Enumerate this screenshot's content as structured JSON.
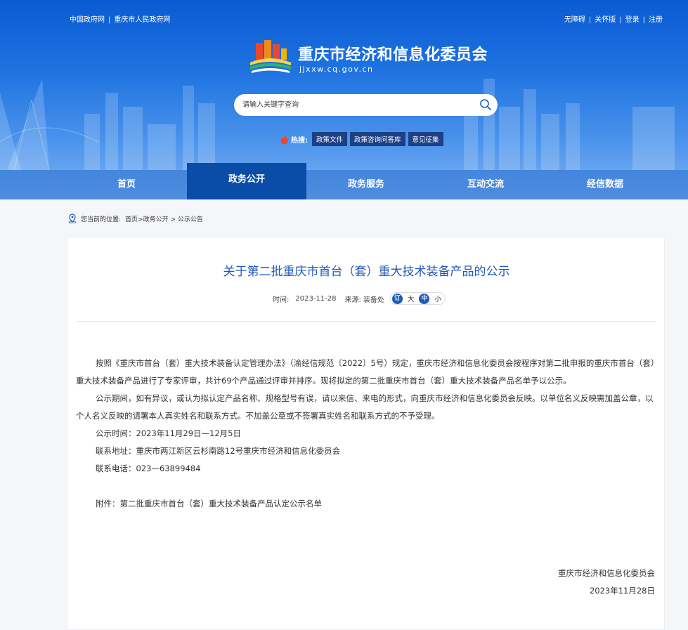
{
  "topbar": {
    "left_links": [
      "中国政府网",
      "重庆市人民政府网"
    ],
    "right_links": [
      "无障碍",
      "关怀版",
      "登录",
      "注册"
    ]
  },
  "site": {
    "title": "重庆市经济和信息化委员会",
    "url": "jjxxw.cq.gov.cn"
  },
  "search": {
    "placeholder": "请输入关键字查询"
  },
  "hot": {
    "label": "热搜:",
    "tags": [
      "政策文件",
      "政策咨询问答库",
      "意见征集"
    ]
  },
  "nav": {
    "items": [
      "首页",
      "政务公开",
      "政务服务",
      "互动交流",
      "经信数据"
    ],
    "active_index": 1
  },
  "breadcrumb": {
    "prefix": "您当前的位置:",
    "path": "首页>政务公开 > 公示公告"
  },
  "article": {
    "title": "关于第二批重庆市首台（套）重大技术装备产品的公示",
    "time_label": "时间:",
    "time_value": "2023-11-28",
    "source_label": "来源:",
    "source_value": "装备处",
    "size_controls": [
      "订",
      "大",
      "中",
      "小"
    ],
    "paragraphs": [
      "按照《重庆市首台（套）重大技术装备认定管理办法》（渝经信规范〔2022〕5号）规定，重庆市经济和信息化委员会按程序对第二批申报的重庆市首台（套）重大技术装备产品进行了专家评审，共计69个产品通过评审并排序。现将拟定的第二批重庆市首台（套）重大技术装备产品名单予以公示。",
      "公示期间，如有异议，或认为拟认定产品名称、规格型号有误，请以来信、来电的形式，向重庆市经济和信息化委员会反映。以单位名义反映需加盖公章，以个人名义反映的请署本人真实姓名和联系方式。不加盖公章或不签署真实姓名和联系方式的不予受理。",
      "公示时间：2023年11月29日—12月5日",
      "联系地址：重庆市两江新区云杉南路12号重庆市经济和信息化委员会",
      "联系电话：023—63899484"
    ],
    "attachment": "附件：第二批重庆市首台（套）重大技术装备产品认定公示名单",
    "signature_org": "重庆市经济和信息化委员会",
    "signature_date": "2023年11月28日"
  },
  "colors": {
    "header_blue": "#1e72e0",
    "nav_active": "#0a4da8",
    "title_blue": "#1e5ab9",
    "hot_tag_bg": "#1c3f86"
  }
}
